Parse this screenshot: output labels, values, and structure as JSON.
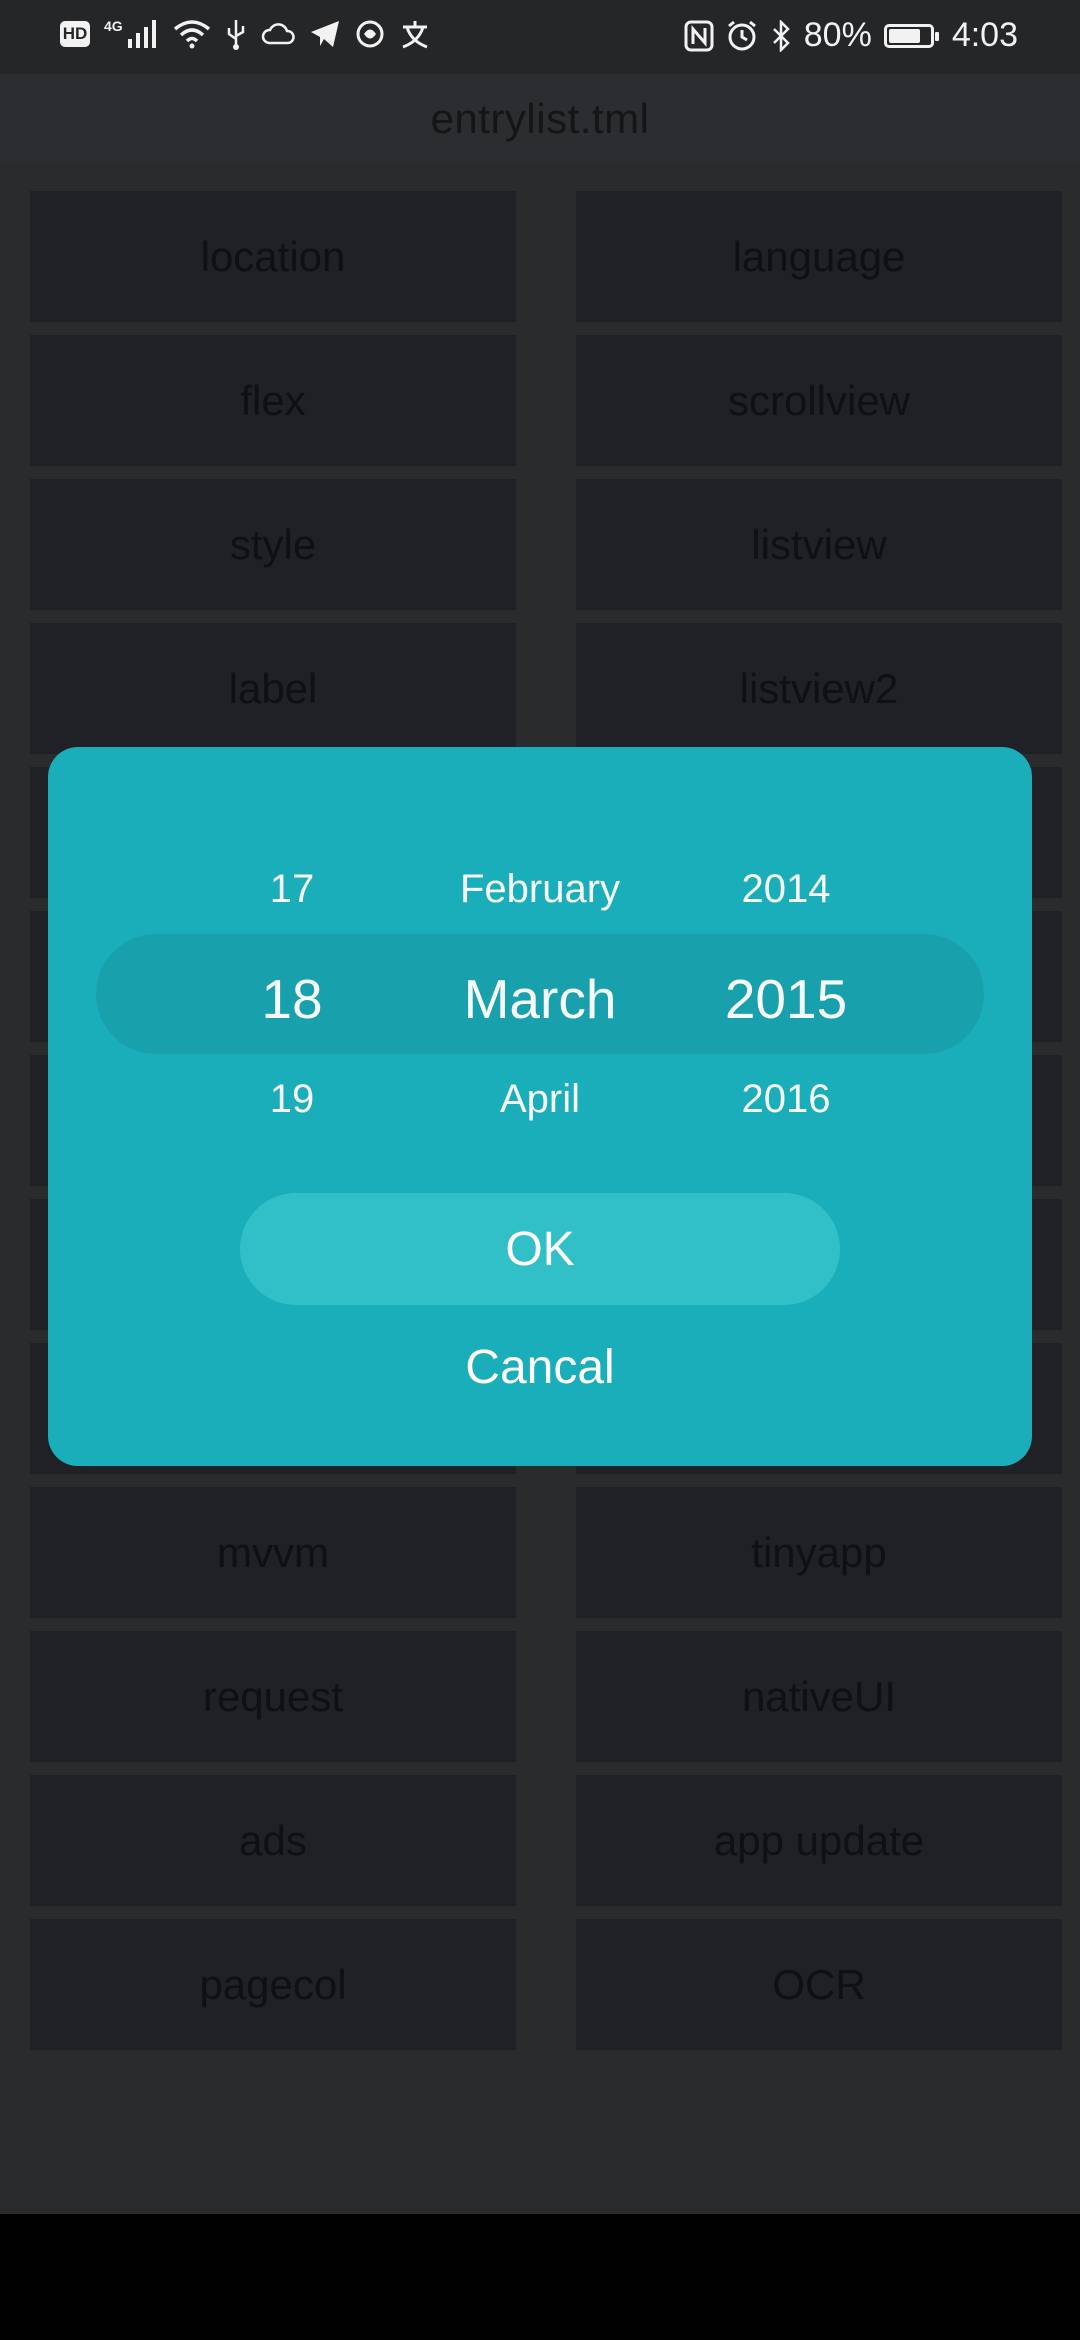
{
  "status_bar": {
    "hd_label": "HD",
    "network_label": "4G",
    "battery_percent_text": "80%",
    "battery_level": 0.8,
    "time": "4:03",
    "left_icons": [
      "hd-icon",
      "signal-icon",
      "wifi-icon",
      "usb-icon",
      "cloud-icon",
      "telegram-icon",
      "app-icon",
      "alipay-icon"
    ],
    "right_icons": [
      "nfc-icon",
      "alarm-icon",
      "bluetooth-icon",
      "battery-icon"
    ]
  },
  "title_bar": {
    "title": "entrylist.tml"
  },
  "grid_items": [
    "location",
    "language",
    "flex",
    "scrollview",
    "style",
    "listview",
    "label",
    "listview2",
    "",
    "",
    "",
    "",
    "",
    "",
    "",
    "",
    "",
    "",
    "mvvm",
    "tinyapp",
    "request",
    "nativeUI",
    "ads",
    "app update",
    "pagecol",
    "OCR"
  ],
  "date_picker": {
    "day": {
      "prev": "17",
      "selected": "18",
      "next": "19"
    },
    "month": {
      "prev": "February",
      "selected": "March",
      "next": "April"
    },
    "year": {
      "prev": "2014",
      "selected": "2015",
      "next": "2016"
    },
    "ok_label": "OK",
    "cancel_label": "Cancal"
  },
  "colors": {
    "dialog_bg": "#1aadba",
    "picker_highlight": "#18a1ad",
    "ok_button": "#32c0c8",
    "tile_bg": "#1f2127"
  }
}
